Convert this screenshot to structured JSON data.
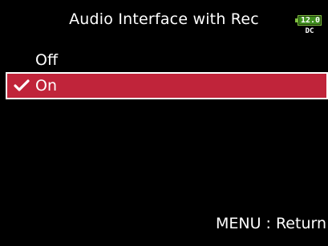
{
  "header": {
    "title": "Audio Interface with Rec",
    "battery": {
      "voltage": "12.0",
      "source": "DC",
      "icon": "battery-icon",
      "color": "#7fbf3f"
    }
  },
  "menu": {
    "options": [
      {
        "label": "Off",
        "selected": false
      },
      {
        "label": "On",
        "selected": true,
        "icon": "check-icon"
      }
    ],
    "highlight_color": "#c0243a"
  },
  "footer": {
    "hint": "MENU : Return"
  }
}
